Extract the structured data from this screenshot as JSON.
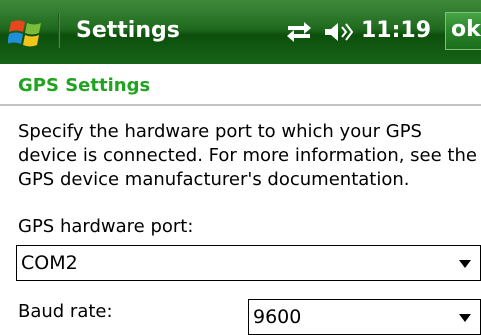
{
  "titlebar": {
    "app_title": "Settings",
    "clock": "11:19",
    "ok_label": "ok",
    "icons": [
      "windows-logo",
      "connectivity-arrows",
      "speaker-volume"
    ]
  },
  "page": {
    "title": "GPS Settings",
    "description": "Specify the hardware port to which your GPS device is connected. For more information, see the GPS device manufacturer's documentation."
  },
  "port": {
    "label": "GPS hardware port:",
    "value": "COM2"
  },
  "baud": {
    "label": "Baud rate:",
    "value": "9600"
  },
  "colors": {
    "titlebar": "#1f6a1e",
    "accent_title": "#21a321",
    "text": "#000000"
  }
}
